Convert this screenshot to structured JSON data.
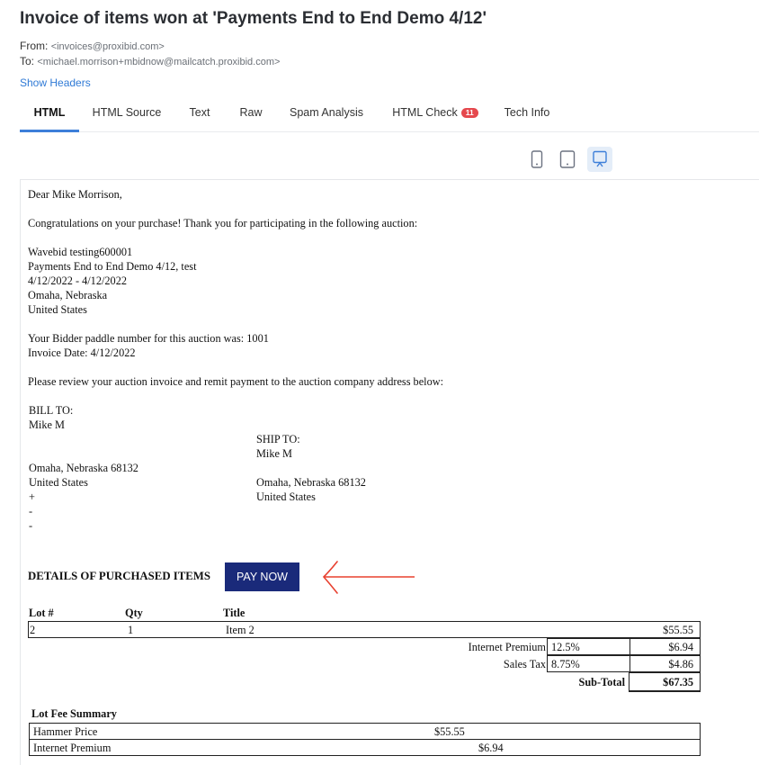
{
  "subject": "Invoice of items won at 'Payments End to End Demo 4/12'",
  "from": {
    "label": "From:",
    "value": "<invoices@proxibid.com>"
  },
  "to": {
    "label": "To:",
    "value": "<michael.morrison+mbidnow@mailcatch.proxibid.com>"
  },
  "show_headers": "Show Headers",
  "tabs": {
    "html": "HTML",
    "html_source": "HTML Source",
    "text": "Text",
    "raw": "Raw",
    "spam": "Spam Analysis",
    "html_check": "HTML Check",
    "html_check_badge": "11",
    "tech": "Tech Info"
  },
  "devices": [
    "mobile-icon",
    "tablet-icon",
    "desktop-icon"
  ],
  "email": {
    "greeting": "Dear Mike Morrison,",
    "congrats": "Congratulations on your purchase! Thank you for participating in the following auction:",
    "auction_lines": [
      "Wavebid testing600001",
      "Payments End to End Demo 4/12, test",
      "4/12/2022 - 4/12/2022",
      "Omaha, Nebraska",
      "United States"
    ],
    "paddle": "Your Bidder paddle number for this auction was: 1001",
    "invoice_date": "Invoice Date: 4/12/2022",
    "review": "Please review your auction invoice and remit payment to the auction company address below:",
    "bill_to": "BILL TO:",
    "bill_name": "Mike M",
    "bill_city": "Omaha, Nebraska 68132",
    "bill_country": "United States",
    "bill_extra": [
      "+",
      "-",
      "-"
    ],
    "ship_to": "SHIP TO:",
    "ship_name": "Mike M",
    "ship_city": "Omaha, Nebraska 68132",
    "ship_country": "United States",
    "details_heading": "DETAILS OF PURCHASED ITEMS",
    "pay_now": "PAY NOW",
    "columns": {
      "lot": "Lot #",
      "qty": "Qty",
      "title": "Title"
    },
    "item": {
      "lot": "2",
      "qty": "1",
      "title": "Item 2",
      "amount": "$55.55"
    },
    "premium": {
      "label": "Internet Premium",
      "rate": "12.5%",
      "amount": "$6.94"
    },
    "tax": {
      "label": "Sales Tax",
      "rate": "8.75%",
      "amount": "$4.86"
    },
    "subtotal": {
      "label": "Sub-Total",
      "amount": "$67.35"
    },
    "fee_summary": "Lot Fee Summary",
    "fees": [
      {
        "label": "Hammer Price",
        "amount": "$55.55"
      },
      {
        "label": "Internet Premium",
        "amount": "$6.94"
      }
    ]
  },
  "colors": {
    "accent": "#3d7fd9",
    "pay_button": "#1a2a7a",
    "badge": "#e5484d",
    "arrow": "#e8402f"
  }
}
